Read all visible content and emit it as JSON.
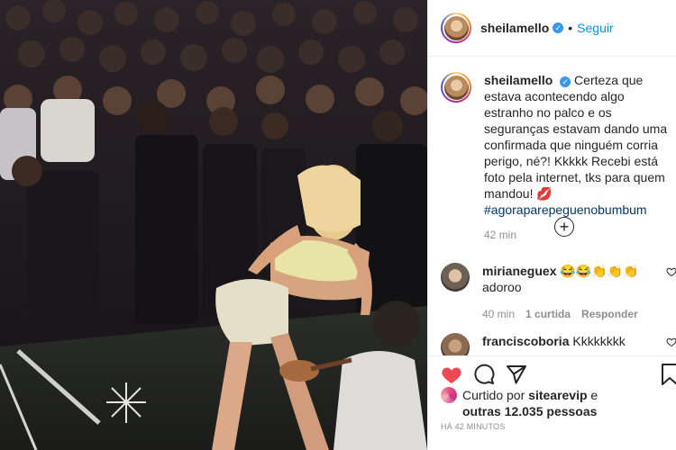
{
  "header": {
    "username": "sheilamello",
    "verified_mark": "✓",
    "separator": "•",
    "follow_label": "Seguir"
  },
  "caption": {
    "username": "sheilamello",
    "text": "Certeza que estava acontecendo algo estranho no palco e os seguranças estavam dando uma confirmada que ninguém corria perigo, né?! Kkkkk Recebi está foto pela internet, tks para quem mandou! 💋 ",
    "hashtag": "#agoraparepeguenobumbum",
    "time": "42 min"
  },
  "load_more": "+",
  "comments": [
    {
      "username": "mirianeguex",
      "text": "😂😂👏👏👏",
      "text2": "adoroo",
      "time": "40 min",
      "likes": "1 curtida",
      "reply": "Responder"
    },
    {
      "username": "franciscoboria",
      "text": "Kkkkkkkk"
    }
  ],
  "actions": {
    "like_icon": "heart-icon",
    "comment_icon": "comment-icon",
    "share_icon": "share-icon",
    "save_icon": "bookmark-icon",
    "like_color": "#ed4956"
  },
  "likes": {
    "prefix": "Curtido por ",
    "user": "sitearevip",
    "connector": " e",
    "others": "outras 12.035 pessoas"
  },
  "timestamp": "Há 42 minutos",
  "colors": {
    "link": "#0095f6",
    "hashtag": "#00376b",
    "muted": "#8e8e8e"
  }
}
